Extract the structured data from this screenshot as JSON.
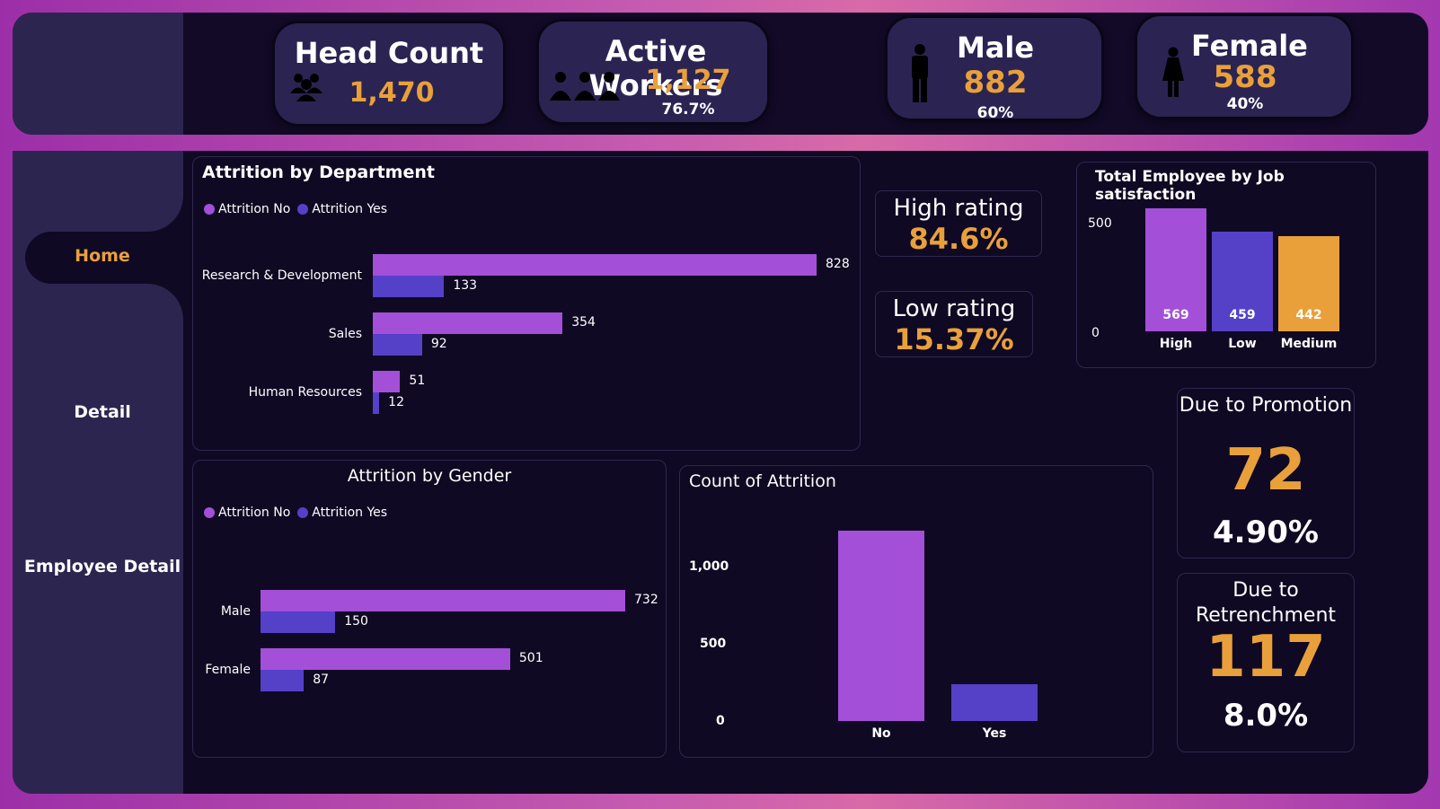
{
  "kpis": {
    "head_count": {
      "title": "Head Count",
      "value": "1,470"
    },
    "active_workers": {
      "title": "Active Workers",
      "value": "1,127",
      "pct": "76.7%"
    },
    "male": {
      "title": "Male",
      "value": "882",
      "pct": "60%"
    },
    "female": {
      "title": "Female",
      "value": "588",
      "pct": "40%"
    }
  },
  "nav": {
    "home": "Home",
    "detail": "Detail",
    "employee_detail": "Employee Detail"
  },
  "colors": {
    "attrition_no": "#a34fd8",
    "attrition_yes": "#5540c8",
    "accent": "#e9a03b"
  },
  "legend": {
    "no": "Attrition No",
    "yes": "Attrition Yes"
  },
  "dept_chart": {
    "title": "Attrition by Department",
    "rows": [
      {
        "label": "Research & Development",
        "no": 828,
        "yes": 133
      },
      {
        "label": "Sales",
        "no": 354,
        "yes": 92
      },
      {
        "label": "Human Resources",
        "no": 51,
        "yes": 12
      }
    ]
  },
  "ratings": {
    "high": {
      "label": "High rating",
      "value": "84.6%"
    },
    "low": {
      "label": "Low rating",
      "value": "15.37%"
    }
  },
  "job_sat": {
    "title": "Total Employee by Job satisfaction",
    "ticks": [
      "500",
      "0"
    ],
    "bars": [
      {
        "label": "High",
        "value": 569,
        "color": "#a34fd8"
      },
      {
        "label": "Low",
        "value": 459,
        "color": "#5540c8"
      },
      {
        "label": "Medium",
        "value": 442,
        "color": "#e9a03b"
      }
    ]
  },
  "promotion": {
    "title": "Due to Promotion",
    "value": "72",
    "pct": "4.90%"
  },
  "retrenchment": {
    "title_line1": "Due to",
    "title_line2": "Retrenchment",
    "value": "117",
    "pct": "8.0%"
  },
  "gender_chart": {
    "title": "Attrition by Gender",
    "rows": [
      {
        "label": "Male",
        "no": 732,
        "yes": 150
      },
      {
        "label": "Female",
        "no": 501,
        "yes": 87
      }
    ]
  },
  "count_chart": {
    "title": "Count of Attrition",
    "ticks": [
      "1,000",
      "500",
      "0"
    ],
    "bars": [
      {
        "label": "No",
        "value": 1233,
        "color": "#a34fd8"
      },
      {
        "label": "Yes",
        "value": 237,
        "color": "#5540c8"
      }
    ]
  },
  "chart_data": [
    {
      "type": "bar",
      "title": "Attrition by Department",
      "orientation": "horizontal",
      "categories": [
        "Research & Development",
        "Sales",
        "Human Resources"
      ],
      "series": [
        {
          "name": "Attrition No",
          "values": [
            828,
            354,
            51
          ]
        },
        {
          "name": "Attrition Yes",
          "values": [
            133,
            92,
            12
          ]
        }
      ]
    },
    {
      "type": "bar",
      "title": "Total Employee by Job satisfaction",
      "categories": [
        "High",
        "Low",
        "Medium"
      ],
      "values": [
        569,
        459,
        442
      ]
    },
    {
      "type": "bar",
      "title": "Attrition by Gender",
      "orientation": "horizontal",
      "categories": [
        "Male",
        "Female"
      ],
      "series": [
        {
          "name": "Attrition No",
          "values": [
            732,
            501
          ]
        },
        {
          "name": "Attrition Yes",
          "values": [
            150,
            87
          ]
        }
      ]
    },
    {
      "type": "bar",
      "title": "Count of Attrition",
      "categories": [
        "No",
        "Yes"
      ],
      "values": [
        1233,
        237
      ],
      "ylim": [
        0,
        1233
      ]
    }
  ]
}
